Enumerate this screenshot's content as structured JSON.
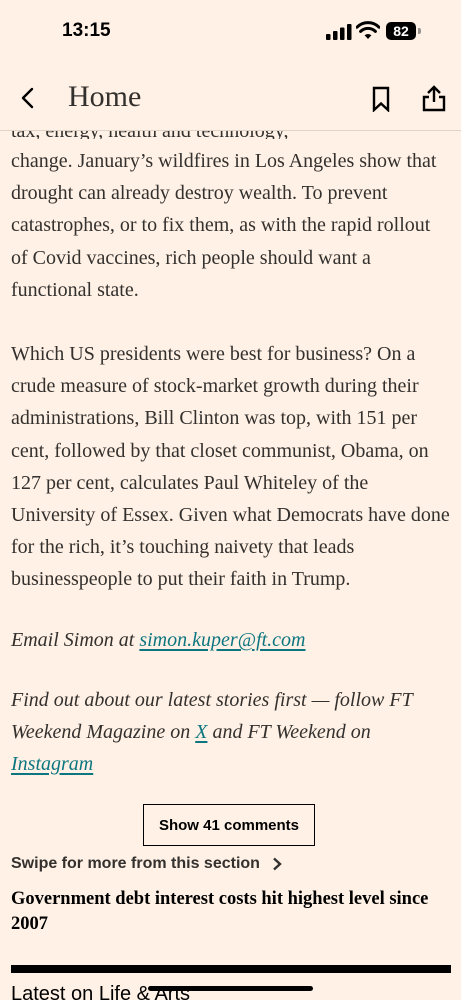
{
  "status_bar": {
    "time": "13:15",
    "battery": "82",
    "icons": [
      "signal-icon",
      "wifi-icon",
      "battery-icon"
    ]
  },
  "nav": {
    "title": "Home",
    "icons": [
      "back-chevron-icon",
      "bookmark-icon",
      "share-icon"
    ]
  },
  "article": {
    "clipped_line": "tax, energy, health and technology,",
    "para1": "change. January’s wildfires in Los Angeles show that drought can already destroy wealth. To prevent catastrophes, or to fix them, as with the rapid rollout of Covid vaccines, rich people should want a functional state.",
    "para2": "Which US presidents were best for business? On a crude measure of stock-market growth during their administrations, Bill Clinton was top, with 151 per cent, followed by that closet communist, Obama, on 127 per cent, calculates Paul Whiteley of the University of Essex. Given what Democrats have done for the rich, it’s touching naivety that leads businesspeople to put their faith in Trump.",
    "email_prefix": "Email Simon at ",
    "email_link": "simon.kuper@ft.com",
    "follow_prefix": "Find out about our latest stories first — follow FT Weekend Magazine on ",
    "follow_x_link": "X",
    "follow_middle": " and FT Weekend on ",
    "follow_instagram_link": "Instagram"
  },
  "comments_button": "Show 41 comments",
  "swipe_label": "Swipe for more from this section",
  "next_headline": "Government debt interest costs hit highest level since 2007",
  "latest_heading": "Latest on Life & Arts",
  "colors": {
    "background": "#fff1e5",
    "text": "#33302e",
    "link": "#0d7680"
  }
}
